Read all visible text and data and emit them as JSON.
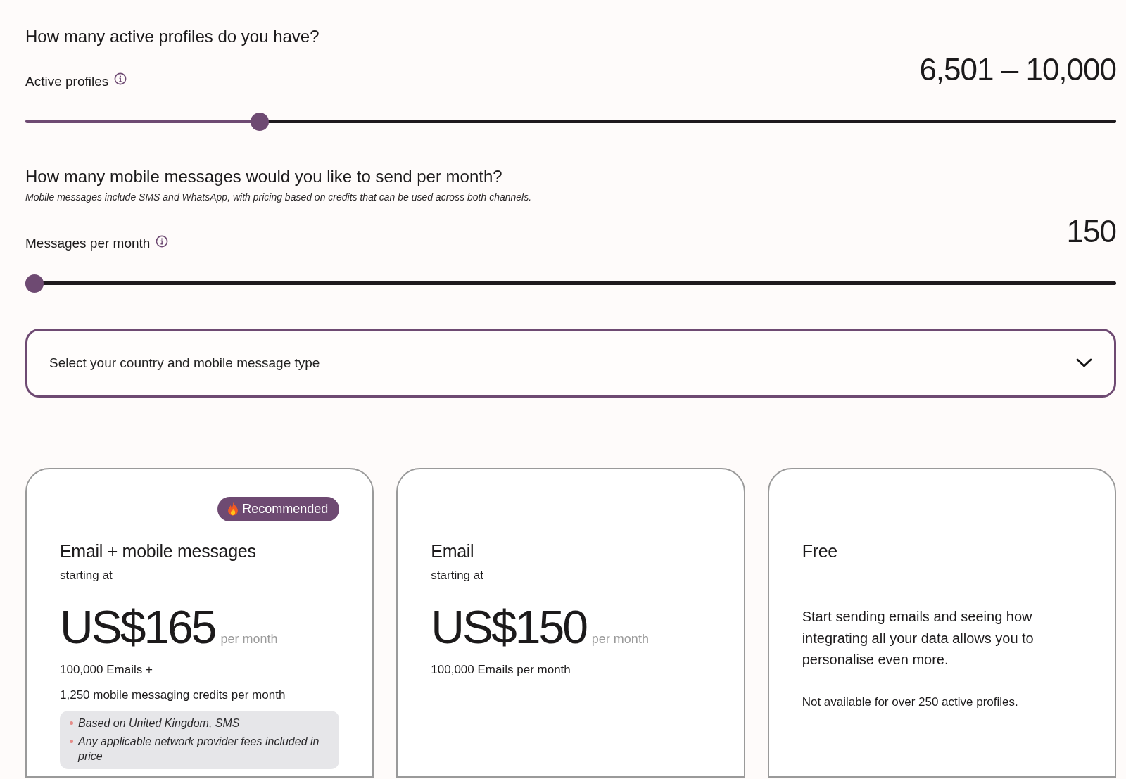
{
  "questions": [
    {
      "title": "How many active profiles do you have?",
      "label": "Active profiles",
      "value": "6,501 – 10,000",
      "slider": {
        "level": 0.21
      }
    },
    {
      "title": "How many mobile messages would you like to send per month?",
      "subtitle": "Mobile messages include SMS and WhatsApp, with pricing based on credits that can be used across both channels.",
      "label": "Messages per month",
      "value": "150",
      "slider": {
        "level": 0
      }
    }
  ],
  "country_select": {
    "placeholder": "Select your country and mobile message type"
  },
  "plans": [
    {
      "kind": "priced",
      "badge": "Recommended",
      "name": "Email + mobile messages",
      "price_caption": "starting at",
      "price": "US$165",
      "period": "per month",
      "features": [
        "100,000 Emails +",
        "1,250 mobile messaging credits per month"
      ],
      "notes": [
        "Based on United Kingdom, SMS",
        "Any applicable network provider fees included in price"
      ]
    },
    {
      "kind": "priced",
      "name": "Email",
      "price_caption": "starting at",
      "price": "US$150",
      "period": "per month",
      "features": [
        "100,000 Emails per month"
      ]
    },
    {
      "kind": "free",
      "name": "Free",
      "description": "Start sending emails and seeing how integrating all your data allows you to personalise even more.",
      "note": "Not available for over 250 active profiles."
    }
  ]
}
